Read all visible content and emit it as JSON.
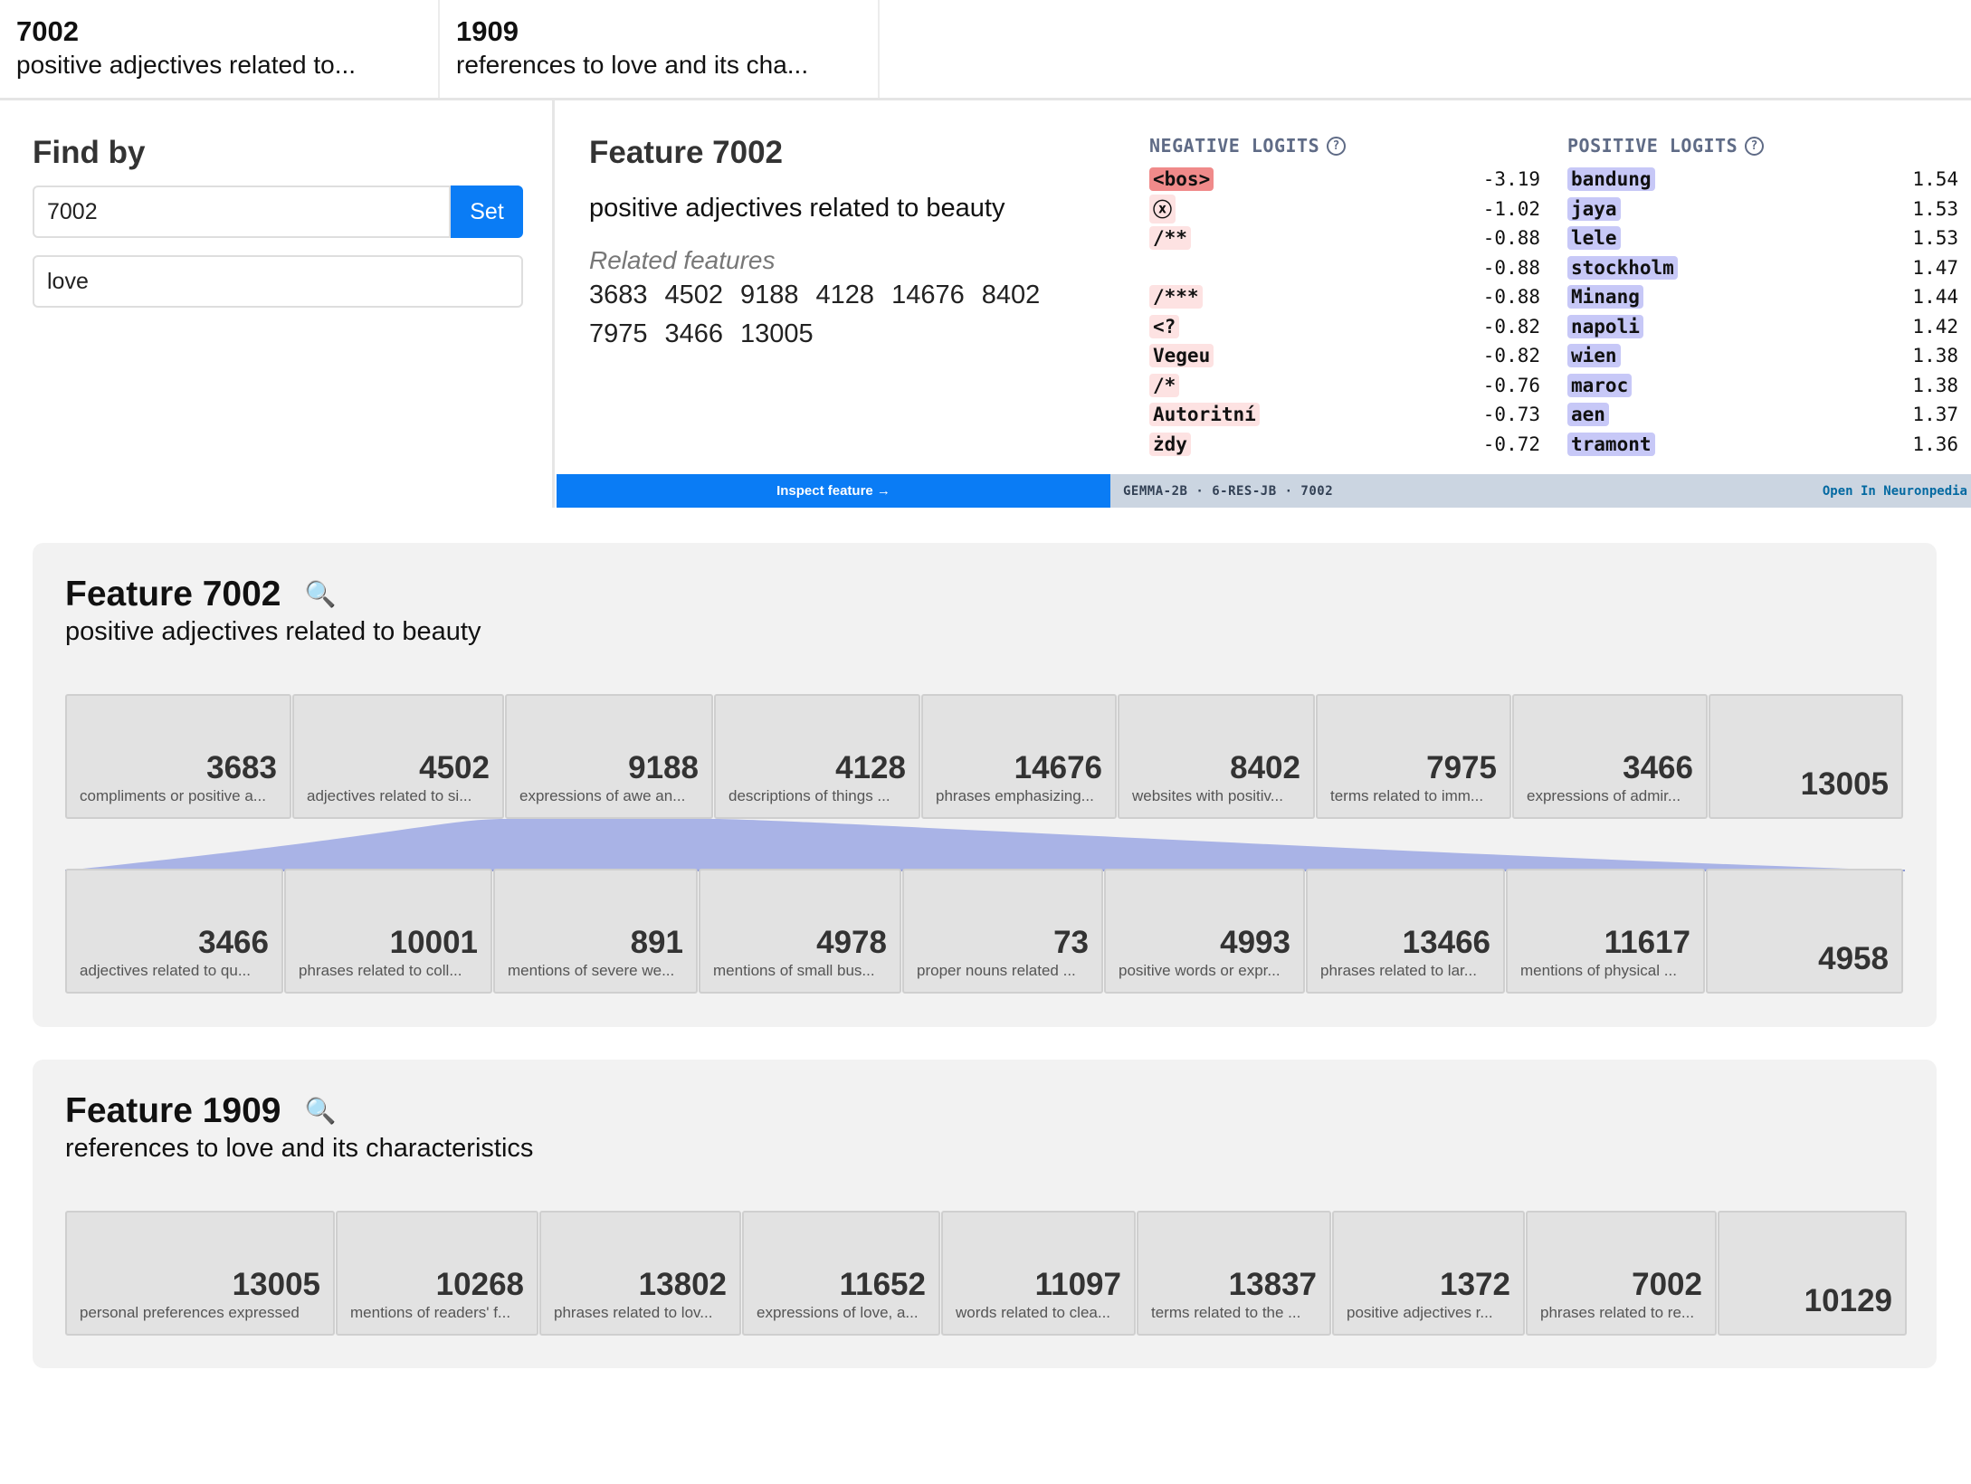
{
  "tabs": [
    {
      "id": "7002",
      "desc": "positive adjectives related to..."
    },
    {
      "id": "1909",
      "desc": "references to love and its cha..."
    }
  ],
  "find": {
    "title": "Find by",
    "id_value": "7002",
    "set_label": "Set",
    "search_value": "love"
  },
  "detail": {
    "title": "Feature 7002",
    "description": "positive adjectives related to beauty",
    "related_title": "Related features",
    "related": [
      "3683",
      "4502",
      "9188",
      "4128",
      "14676",
      "8402",
      "7975",
      "3466",
      "13005"
    ],
    "inspect_label": "Inspect feature  →"
  },
  "logits": {
    "negative_title": "NEGATIVE LOGITS",
    "positive_title": "POSITIVE LOGITS",
    "negative": [
      {
        "token": "<bos>",
        "value": "-3.19",
        "color": "#f08a8a"
      },
      {
        "token": "ⓧ",
        "value": "-1.02",
        "color": "#fde2e2"
      },
      {
        "token": "/**",
        "value": "-0.88",
        "color": "#fde2e2"
      },
      {
        "token": "",
        "value": "-0.88",
        "color": "#fde2e2"
      },
      {
        "token": "/***",
        "value": "-0.88",
        "color": "#fde2e2"
      },
      {
        "token": "<?",
        "value": "-0.82",
        "color": "#fde2e2"
      },
      {
        "token": "Vegeu",
        "value": "-0.82",
        "color": "#fde2e2"
      },
      {
        "token": "/*",
        "value": "-0.76",
        "color": "#fde2e2"
      },
      {
        "token": "Autoritní",
        "value": "-0.73",
        "color": "#fde2e2"
      },
      {
        "token": "żdy",
        "value": "-0.72",
        "color": "#fde2e2"
      }
    ],
    "positive": [
      {
        "token": "bandung",
        "value": "1.54",
        "color": "#c7c8f7"
      },
      {
        "token": "jaya",
        "value": "1.53",
        "color": "#c7c8f7"
      },
      {
        "token": "lele",
        "value": "1.53",
        "color": "#c7c8f7"
      },
      {
        "token": "stockholm",
        "value": "1.47",
        "color": "#c7c8f7"
      },
      {
        "token": "Minang",
        "value": "1.44",
        "color": "#c7c8f7"
      },
      {
        "token": "napoli",
        "value": "1.42",
        "color": "#c7c8f7"
      },
      {
        "token": "wien",
        "value": "1.38",
        "color": "#c7c8f7"
      },
      {
        "token": "maroc",
        "value": "1.38",
        "color": "#c7c8f7"
      },
      {
        "token": "aen",
        "value": "1.37",
        "color": "#c7c8f7"
      },
      {
        "token": "tramont",
        "value": "1.36",
        "color": "#c7c8f7"
      }
    ],
    "footer_left": "GEMMA-2B · 6-RES-JB · 7002",
    "footer_right": "Open In Neuronpedia"
  },
  "card1": {
    "title": "Feature 7002",
    "description": "positive adjectives related to beauty",
    "row1": [
      {
        "id": "3683",
        "label": "compliments or positive a..."
      },
      {
        "id": "4502",
        "label": "adjectives related to si..."
      },
      {
        "id": "9188",
        "label": "expressions of awe an..."
      },
      {
        "id": "4128",
        "label": "descriptions of things ..."
      },
      {
        "id": "14676",
        "label": "phrases emphasizing..."
      },
      {
        "id": "8402",
        "label": "websites with positiv..."
      },
      {
        "id": "7975",
        "label": "terms related to imm..."
      },
      {
        "id": "3466",
        "label": "expressions of admir..."
      },
      {
        "id": "13005",
        "label": ""
      }
    ],
    "row2": [
      {
        "id": "3466",
        "label": "adjectives related to qu..."
      },
      {
        "id": "10001",
        "label": "phrases related to coll..."
      },
      {
        "id": "891",
        "label": "mentions of severe we..."
      },
      {
        "id": "4978",
        "label": "mentions of small bus..."
      },
      {
        "id": "73",
        "label": "proper nouns related ..."
      },
      {
        "id": "4993",
        "label": "positive words or expr..."
      },
      {
        "id": "13466",
        "label": "phrases related to lar..."
      },
      {
        "id": "11617",
        "label": "mentions of physical ..."
      },
      {
        "id": "4958",
        "label": ""
      }
    ]
  },
  "card2": {
    "title": "Feature 1909",
    "description": "references to love and its characteristics",
    "row1": [
      {
        "id": "13005",
        "label": "personal preferences expressed"
      },
      {
        "id": "10268",
        "label": "mentions of readers' f..."
      },
      {
        "id": "13802",
        "label": "phrases related to lov..."
      },
      {
        "id": "11652",
        "label": "expressions of love, a..."
      },
      {
        "id": "11097",
        "label": "words related to clea..."
      },
      {
        "id": "13837",
        "label": "terms related to the ..."
      },
      {
        "id": "1372",
        "label": "positive adjectives r..."
      },
      {
        "id": "7002",
        "label": "phrases related to re..."
      },
      {
        "id": "10129",
        "label": ""
      }
    ]
  },
  "colors": {
    "accent": "#0a7cf5",
    "connector": "#a9b3e6"
  }
}
